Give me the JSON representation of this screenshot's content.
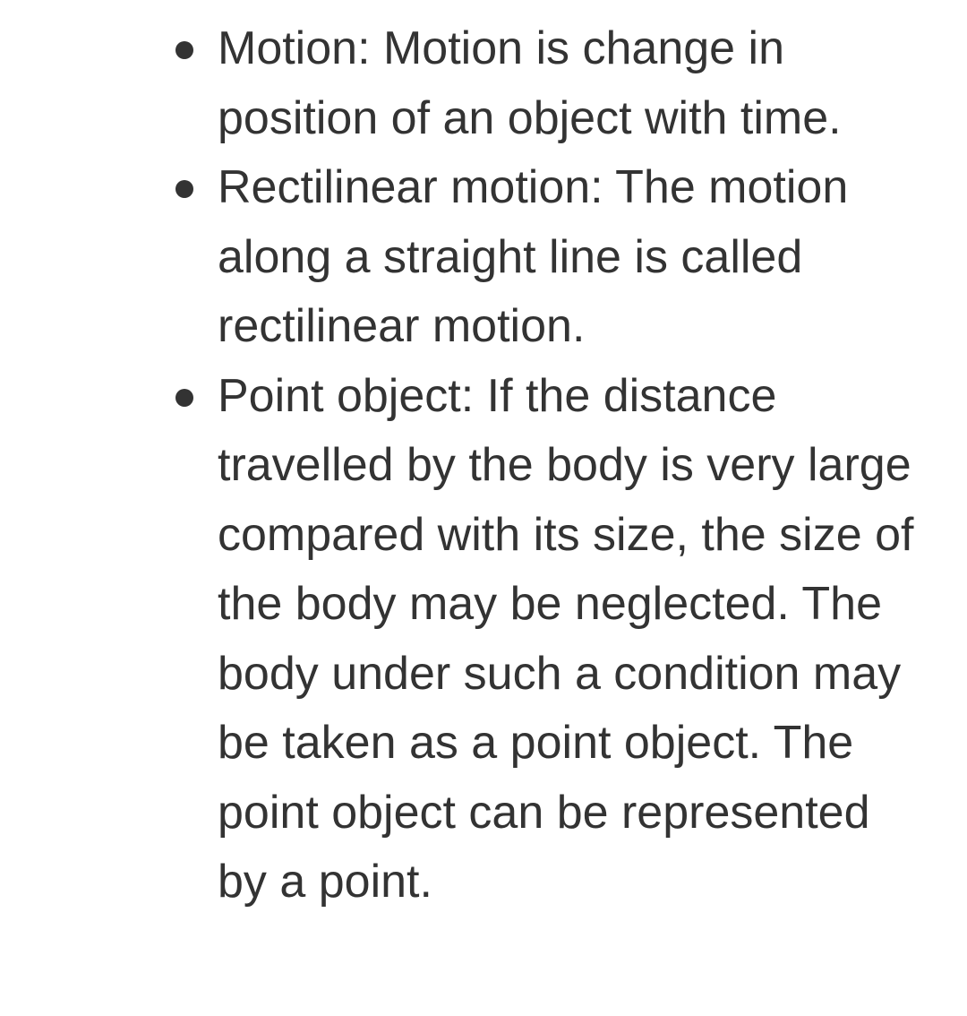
{
  "items": [
    {
      "text": "Motion: Motion is change in position of an object with time."
    },
    {
      "text": "Rectilinear motion: The motion along a straight line is called rectilinear motion."
    },
    {
      "text": "Point object: If the distance travelled by the body is very large compared with its size, the size of the body may be neglected. The body under such a condition may be taken as a point object. The point object can be represented by a point."
    }
  ]
}
